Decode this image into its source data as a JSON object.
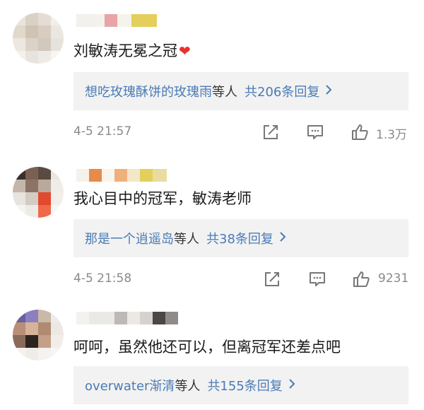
{
  "comments": [
    {
      "text": "刘敏涛无冕之冠",
      "has_heart": true,
      "reply": {
        "names": "想吃玫瑰酥饼的玫瑰雨",
        "etc": "等人",
        "count_text": "共206条回复"
      },
      "timestamp": "4-5 21:57",
      "likes": "1.3万"
    },
    {
      "text": "我心目中的冠军，敏涛老师",
      "has_heart": false,
      "reply": {
        "names": "那是一个逍遥岛",
        "etc": "等人",
        "count_text": "共38条回复"
      },
      "timestamp": "4-5 21:58",
      "likes": "9231"
    },
    {
      "text": "呵呵，虽然他还可以，但离冠军还差点吧",
      "has_heart": false,
      "reply": {
        "names": "overwater渐清",
        "etc": "等人",
        "count_text": "共155条回复"
      }
    }
  ],
  "icons": {
    "heart": "red-heart-icon",
    "share": "share-icon",
    "comment": "comment-icon",
    "like": "thumbs-up-icon",
    "chevron": "chevron-right-icon"
  },
  "colors": {
    "link": "#4a7bb5",
    "reply_bg": "#f2f2f2",
    "meta": "#8a8a8a",
    "heart": "#e8322e"
  }
}
